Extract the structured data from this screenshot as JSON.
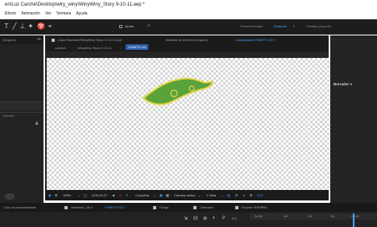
{
  "window": {
    "title": "en\\Luz Carché\\Desktop\\wiry_winy\\WinyWiny_Story 9-10-11.aep *"
  },
  "menu": {
    "items": [
      "Efecto",
      "Animación",
      "Ver",
      "Ventana",
      "Ayuda"
    ]
  },
  "toolbar": {
    "workspace_items": [
      "Predeterminado",
      "Estándar",
      "Pantalla pequeña"
    ],
    "align_label": "Ajuste"
  },
  "left_panel": {
    "tab": "(ninguno)",
    "section_label": "Controles"
  },
  "comp_header": {
    "row1": "Capa  Kikeester/WinyWiny Story 9-10-11.psd",
    "row1b": "Material de archivo  (ninguno)",
    "comp_tab": "Composición  VOMITO XD  ≡",
    "breadcrumb": [
      "vomito1",
      "WinyWiny Story 9-10-11",
      "VOMITO XD"
    ]
  },
  "viewer": {
    "zoom": "100%",
    "timecode": "0;00;10;27",
    "resolution": "Completa",
    "camera": "Cámara activa",
    "views": "1 Vista",
    "exposure": "+0,0"
  },
  "right_panel": {
    "title": "Borrador v"
  },
  "timeline": {
    "tabs": [
      "Cola de procesamiento",
      "chamaco_1fn  ≡",
      "VOMITO XD  ≡",
      "Fuego",
      "Chamaco",
      "Expose SOMBRA"
    ],
    "ruler_marks": [
      "0s:00f",
      "05f",
      "10f",
      "15f",
      "01:00f"
    ]
  },
  "colors": {
    "panel_dark": "#1d1d1d",
    "accent_blue": "#4aa3ff",
    "shape_green": "#5aa33a",
    "shape_outline": "#e5d54a"
  }
}
